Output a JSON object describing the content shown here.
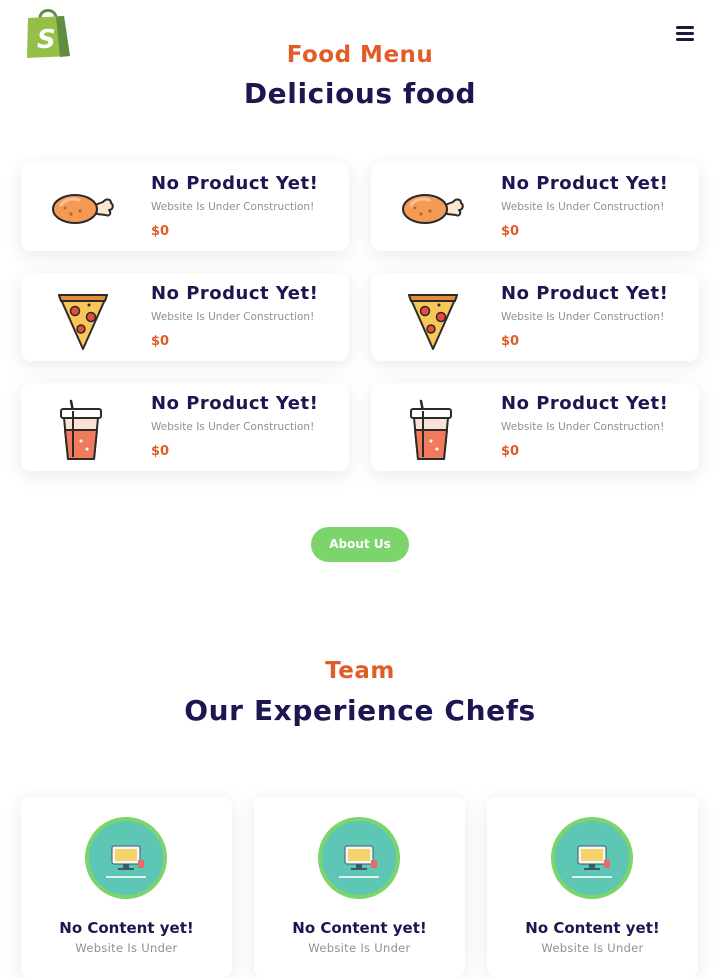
{
  "header": {
    "logo_icon": "shopify-bag-logo",
    "menu_icon": "hamburger-menu-icon"
  },
  "food_section": {
    "kicker": "Food Menu",
    "title": "Delicious food",
    "items": [
      {
        "name": "No Product Yet!",
        "description": "Website Is Under Construction!",
        "price": "$0",
        "icon": "chicken-leg-icon"
      },
      {
        "name": "No Product Yet!",
        "description": "Website Is Under Construction!",
        "price": "$0",
        "icon": "chicken-leg-icon"
      },
      {
        "name": "No Product Yet!",
        "description": "Website Is Under Construction!",
        "price": "$0",
        "icon": "pizza-slice-icon"
      },
      {
        "name": "No Product Yet!",
        "description": "Website Is Under Construction!",
        "price": "$0",
        "icon": "pizza-slice-icon"
      },
      {
        "name": "No Product Yet!",
        "description": "Website Is Under Construction!",
        "price": "$0",
        "icon": "drink-cup-icon"
      },
      {
        "name": "No Product Yet!",
        "description": "Website Is Under Construction!",
        "price": "$0",
        "icon": "drink-cup-icon"
      }
    ],
    "about_button": "About Us"
  },
  "team_section": {
    "kicker": "Team",
    "title": "Our Experience Chefs",
    "chefs": [
      {
        "name": "No Content yet!",
        "description": "Website Is Under",
        "avatar": "under-construction-avatar"
      },
      {
        "name": "No Content yet!",
        "description": "Website Is Under",
        "avatar": "under-construction-avatar"
      },
      {
        "name": "No Content yet!",
        "description": "Website Is Under",
        "avatar": "under-construction-avatar"
      }
    ]
  },
  "colors": {
    "accent": "#e25c28",
    "heading": "#1c1750",
    "button": "#7bd46c",
    "muted_text": "#8f8f97"
  }
}
